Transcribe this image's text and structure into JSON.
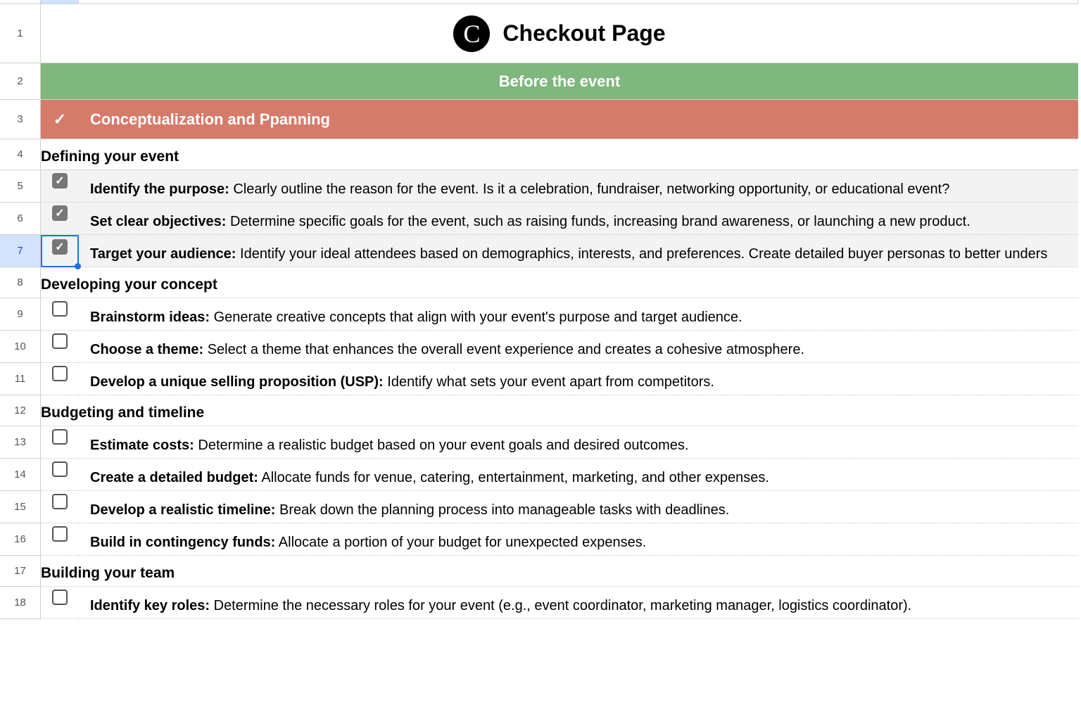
{
  "title": "Checkout Page",
  "section_green": "Before the event",
  "section_red": "Conceptualization and Ppanning",
  "subheads": {
    "s4": "Defining your event",
    "s8": "Developing your concept",
    "s12": "Budgeting and timeline",
    "s17": "Building your team"
  },
  "items": {
    "r5": {
      "bold": "Identify the purpose:",
      "rest": " Clearly outline the reason for the event. Is it a celebration, fundraiser, networking opportunity, or educational event?"
    },
    "r6": {
      "bold": "Set clear objectives:",
      "rest": " Determine specific goals for the event, such as raising funds, increasing brand awareness, or launching a new product."
    },
    "r7": {
      "bold": "Target your audience:",
      "rest": " Identify your ideal attendees based on demographics, interests, and preferences. Create detailed buyer personas to better unders"
    },
    "r9": {
      "bold": "Brainstorm ideas:",
      "rest": " Generate creative concepts that align with your event's purpose and target audience."
    },
    "r10": {
      "bold": "Choose a theme:",
      "rest": " Select a theme that enhances the overall event experience and creates a cohesive atmosphere."
    },
    "r11": {
      "bold": "Develop a unique selling proposition (USP):",
      "rest": " Identify what sets your event apart from competitors."
    },
    "r13": {
      "bold": "Estimate costs:",
      "rest": " Determine a realistic budget based on your event goals and desired outcomes."
    },
    "r14": {
      "bold": "Create a detailed budget:",
      "rest": " Allocate funds for venue, catering, entertainment, marketing, and other expenses."
    },
    "r15": {
      "bold": "Develop a realistic timeline:",
      "rest": " Break down the planning process into manageable tasks with deadlines."
    },
    "r16": {
      "bold": "Build in contingency funds:",
      "rest": " Allocate a portion of your budget for unexpected expenses."
    },
    "r18": {
      "bold": "Identify key roles:",
      "rest": " Determine the necessary roles for your event (e.g., event coordinator, marketing manager, logistics coordinator)."
    }
  },
  "rownums": [
    "1",
    "2",
    "3",
    "4",
    "5",
    "6",
    "7",
    "8",
    "9",
    "10",
    "11",
    "12",
    "13",
    "14",
    "15",
    "16",
    "17",
    "18"
  ]
}
